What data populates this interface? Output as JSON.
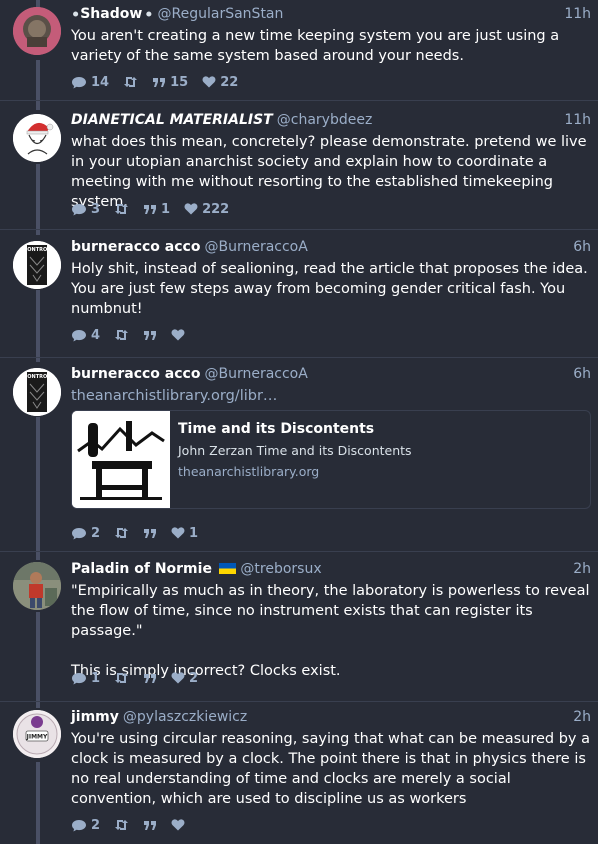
{
  "statuses": [
    {
      "display_name": "Shadow",
      "emoji_left": "⚫",
      "emoji_right": "⚫",
      "account": "@RegularSanStan",
      "time": "11h",
      "text": "You aren't creating a new time keeping system you are just using a variety of the same system based around your needs.",
      "replies": "14",
      "boosts": "",
      "quotes": "15",
      "likes": "22"
    },
    {
      "display_name": "DIANETICAL MATERIALIST",
      "account": "@charybdeez",
      "time": "11h",
      "text": "what does this mean, concretely? please demonstrate. pretend we live in your utopian anarchist society and explain how to coordinate a meeting with me without resorting to the established timekeeping system.",
      "replies": "3",
      "boosts": "",
      "quotes": "1",
      "likes": "222"
    },
    {
      "display_name": "burneracco acco",
      "account": "@BurneraccoA",
      "time": "6h",
      "text": "Holy shit, instead of sealioning, read the article that proposes the idea. You are just few steps away from becoming gender critical fash. You numbnut!",
      "replies": "4",
      "boosts": "",
      "quotes": "",
      "likes": ""
    },
    {
      "display_name": "burneracco acco",
      "account": "@BurneraccoA",
      "time": "6h",
      "text": "theanarchistlibrary.org/libr…",
      "card": {
        "title": "Time and its Discontents",
        "description": "John Zerzan Time and its Discontents",
        "host": "theanarchistlibrary.org"
      },
      "replies": "2",
      "boosts": "",
      "quotes": "",
      "likes": "1"
    },
    {
      "display_name": "Paladin of Normie",
      "flag": "🇺🇦",
      "account": "@treborsux",
      "time": "2h",
      "text": "\"Empirically as much as in theory, the laboratory is powerless to reveal the flow of time, since no instrument exists that can register its passage.\"",
      "text2": "This is simply incorrect? Clocks exist.",
      "replies": "1",
      "boosts": "",
      "quotes": "",
      "likes": "2"
    },
    {
      "display_name": "jimmy",
      "account": "@pylaszczkiewicz",
      "time": "2h",
      "text": "You're using circular reasoning, saying that what can be measured by a clock is measured by a clock. The point there is that in physics there is no real understanding of time and clocks are merely a social convention, which are used to discipline us as workers",
      "replies": "2",
      "boosts": "",
      "quotes": "",
      "likes": ""
    }
  ],
  "avatar_labels": {
    "control": "CONTROL",
    "jimmy": "JIMMY"
  },
  "icons": {
    "reply": "reply-icon",
    "boost": "boost-icon",
    "quote": "quote-icon",
    "like": "heart-icon"
  },
  "colors": {
    "background": "#282c37",
    "muted": "#9baec8",
    "text": "#ffffff",
    "thread_line": "#4a5065"
  }
}
